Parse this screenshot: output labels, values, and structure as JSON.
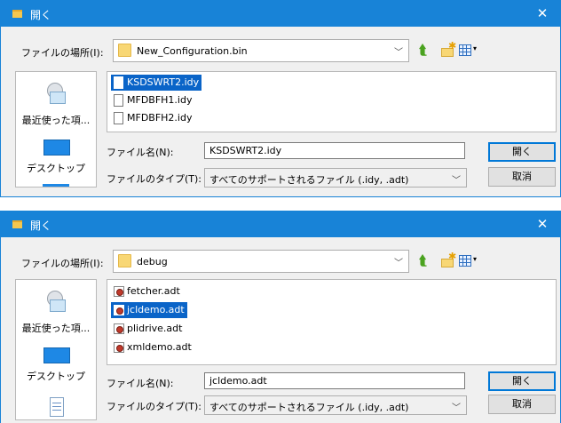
{
  "dialogs": [
    {
      "title": "開く",
      "close_label": "✕",
      "lookin_label": "ファイルの場所(I):",
      "lookin_value": "New_Configuration.bin",
      "places": [
        {
          "label": "最近使った項..."
        },
        {
          "label": "デスクトップ"
        }
      ],
      "files": [
        "KSDSWRT2.idy",
        "MFDBFH1.idy",
        "MFDBFH2.idy"
      ],
      "selected_file": "KSDSWRT2.idy",
      "filename_label": "ファイル名(N):",
      "filename_value": "KSDSWRT2.idy",
      "filetype_label": "ファイルのタイプ(T):",
      "filetype_value": "すべてのサポートされるファイル (.idy, .adt)",
      "open_button": "開く",
      "cancel_button": "取消"
    },
    {
      "title": "開く",
      "close_label": "✕",
      "lookin_label": "ファイルの場所(I):",
      "lookin_value": "debug",
      "places": [
        {
          "label": "最近使った項..."
        },
        {
          "label": "デスクトップ"
        }
      ],
      "files": [
        "fetcher.adt",
        "jcldemo.adt",
        "plidrive.adt",
        "xmldemo.adt"
      ],
      "selected_file": "jcldemo.adt",
      "filename_label": "ファイル名(N):",
      "filename_value": "jcldemo.adt",
      "filetype_label": "ファイルのタイプ(T):",
      "filetype_value": "すべてのサポートされるファイル (.idy, .adt)",
      "open_button": "開く",
      "cancel_button": "取消"
    }
  ],
  "colors": {
    "titlebar": "#1883d7",
    "selection": "#0a64c8",
    "dialog_bg": "#f0f0f0"
  },
  "icons": [
    "folder-icon",
    "up-folder-icon",
    "new-folder-icon",
    "view-menu-icon",
    "recent-items-icon",
    "desktop-icon",
    "document-icon",
    "adt-file-icon",
    "close-icon"
  ]
}
